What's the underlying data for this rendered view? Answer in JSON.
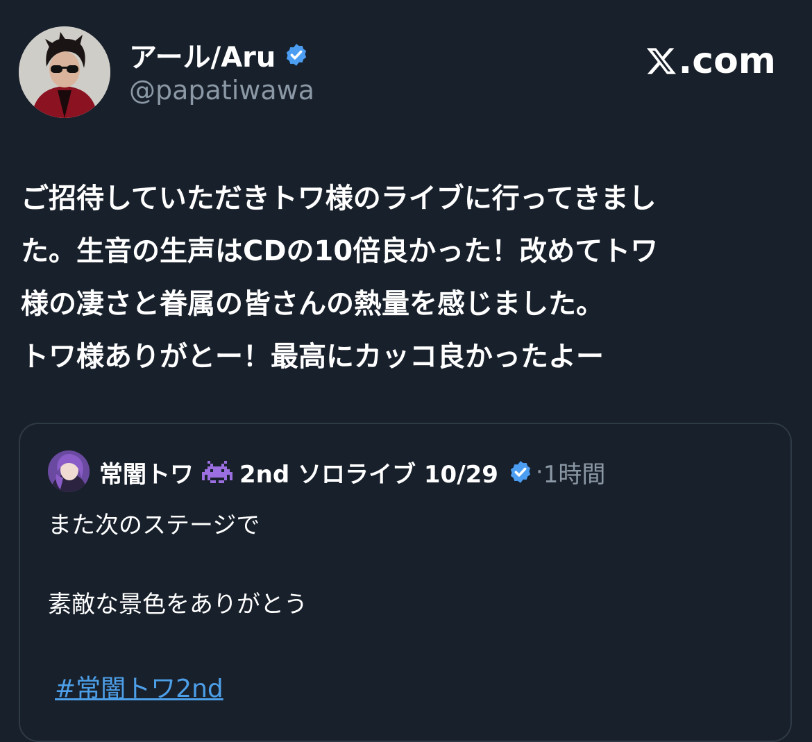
{
  "author": {
    "display_name": "アール/Aru",
    "handle": "@papatiwawa",
    "verified_icon": "verified-badge-icon",
    "avatar": "profile-photo"
  },
  "brand": {
    "logo": "x-logo-icon",
    "text": ".com"
  },
  "tweet": {
    "lines": [
      "ご招待していただきトワ様のライブに行ってきまし",
      "た。生音の生声はCDの10倍良かった！改めてトワ",
      "様の凄さと眷属の皆さんの熱量を感じました。",
      "トワ様ありがとー！最高にカッコ良かったよー"
    ]
  },
  "quote": {
    "display_name": "常闇トワ",
    "emoji_icon": "space-invader-icon",
    "name_suffix": "2nd ソロライブ 10/29",
    "verified_icon": "verified-badge-icon",
    "separator": "·",
    "time": "1時間",
    "lines": [
      "また次のステージで",
      "素敵な景色をありがとう"
    ],
    "hashtag": "#常闇トワ2nd"
  },
  "colors": {
    "background": "#18202b",
    "text": "#ffffff",
    "muted": "#8b98a5",
    "verified": "#4c9ef3",
    "link": "#4d9fe8",
    "border": "#2f3a47"
  }
}
